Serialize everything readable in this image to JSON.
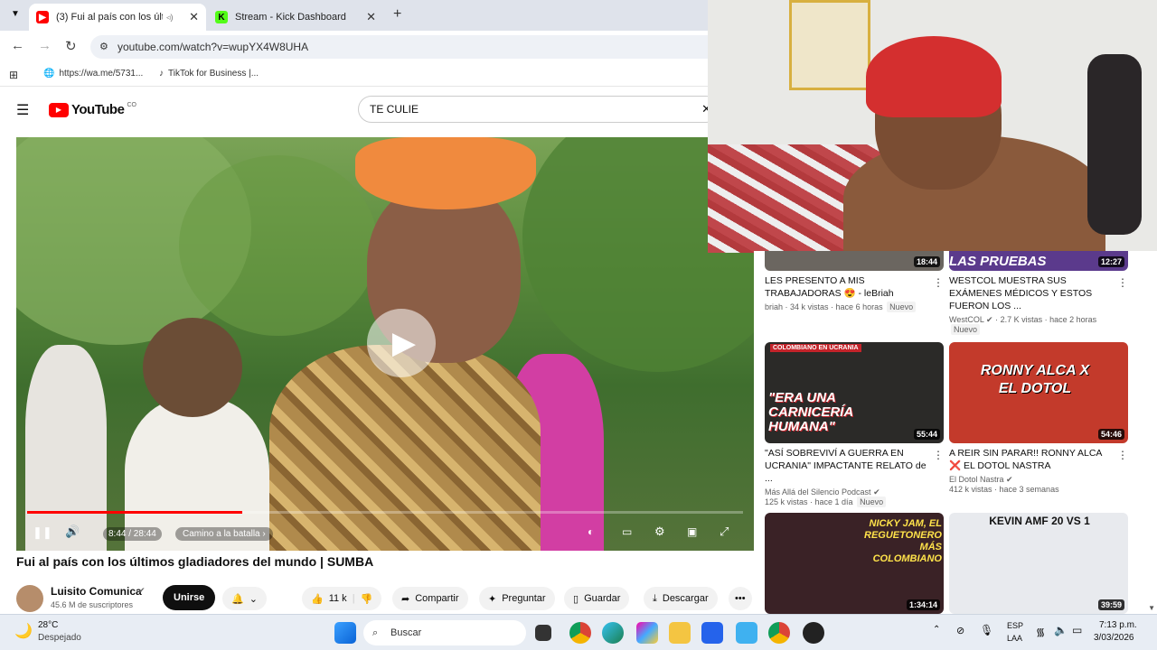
{
  "tabs": [
    {
      "label": "(3) Fui al país con los últim",
      "active": true,
      "favicon": "youtube-icon"
    },
    {
      "label": "Stream - Kick Dashboard",
      "active": false,
      "favicon": "kick-icon"
    }
  ],
  "address": {
    "url": "youtube.com/watch?v=wupYX4W8UHA"
  },
  "bookmarks": [
    {
      "label": "https://wa.me/5731...",
      "icon": "globe-icon"
    },
    {
      "label": "TikTok for Business |...",
      "icon": "tiktok-icon"
    }
  ],
  "youtube": {
    "logo": "YouTube",
    "region": "CO",
    "search_value": "TE CULIE"
  },
  "player": {
    "time": "8:44 / 28:44",
    "chapter": "Camino a la batalla",
    "progress": 0.3,
    "paused": true
  },
  "video": {
    "title": "Fui al país con los últimos gladiadores del mundo | SUMBA",
    "channel": "Luisito Comunica",
    "subscribers": "45.6 M de suscriptores",
    "join": "Unirse",
    "likes": "11 k",
    "share": "Compartir",
    "ask": "Preguntar",
    "save": "Guardar",
    "download": "Descargar"
  },
  "recommendations": [
    {
      "title": "LES PRESENTO A MIS TRABAJADORAS 😍 - leBriah",
      "channel": "briah",
      "views": "34 k vistas",
      "age": "hace 6 horas",
      "badge": "Nuevo",
      "duration": "18:44",
      "thumb_text": "",
      "color": "#6b6660"
    },
    {
      "title": "WESTCOL MUESTRA SUS EXÁMENES MÉDICOS Y ESTOS FUERON LOS ...",
      "channel": "WestCOL",
      "views": "2.7 K vistas",
      "age": "hace 2 horas",
      "badge": "Nuevo",
      "duration": "12:27",
      "thumb_text": "LAS PRUEBAS",
      "color": "#5b3a8c"
    },
    {
      "title": "\"ASÍ SOBREVIVÍ A GUERRA EN UCRANIA\" IMPACTANTE RELATO de ...",
      "channel": "Más Allá del Silencio Podcast",
      "views": "125 k vistas",
      "age": "hace 1 día",
      "badge": "Nuevo",
      "duration": "55:44",
      "thumb_text": "\"ERA UNA CARNICERÍA HUMANA\"",
      "thumb_top": "COLOMBIANO EN UCRANIA",
      "color": "#2b2a28"
    },
    {
      "title": "A REIR SIN PARAR!! RONNY ALCA ❌ EL DOTOL NASTRA",
      "channel": "El Dotol Nastra",
      "views": "412 k vistas",
      "age": "hace 3 semanas",
      "badge": "",
      "duration": "54:46",
      "thumb_text": "RONNY ALCA X EL DOTOL",
      "color": "#c33a2b"
    },
    {
      "title": "",
      "channel": "",
      "views": "",
      "age": "",
      "badge": "",
      "duration": "1:34:14",
      "thumb_text": "NICKY JAM, EL REGUETONERO MÁS COLOMBIANO",
      "color": "#3a2226"
    },
    {
      "title": "",
      "channel": "",
      "views": "",
      "age": "",
      "badge": "",
      "duration": "39:59",
      "thumb_text": "KEVIN AMF 20 VS 1",
      "color": "#e8eaee"
    }
  ],
  "taskbar": {
    "temp": "28°C",
    "weather": "Despejado",
    "search": "Buscar",
    "lang1": "ESP",
    "lang2": "LAA",
    "time": "7:13 p.m.",
    "date": "3/03/2026"
  },
  "colors": {
    "yt_red": "#ff0000",
    "kick_green": "#53fc18",
    "chrome_tab_bg": "#dfe3eb"
  }
}
